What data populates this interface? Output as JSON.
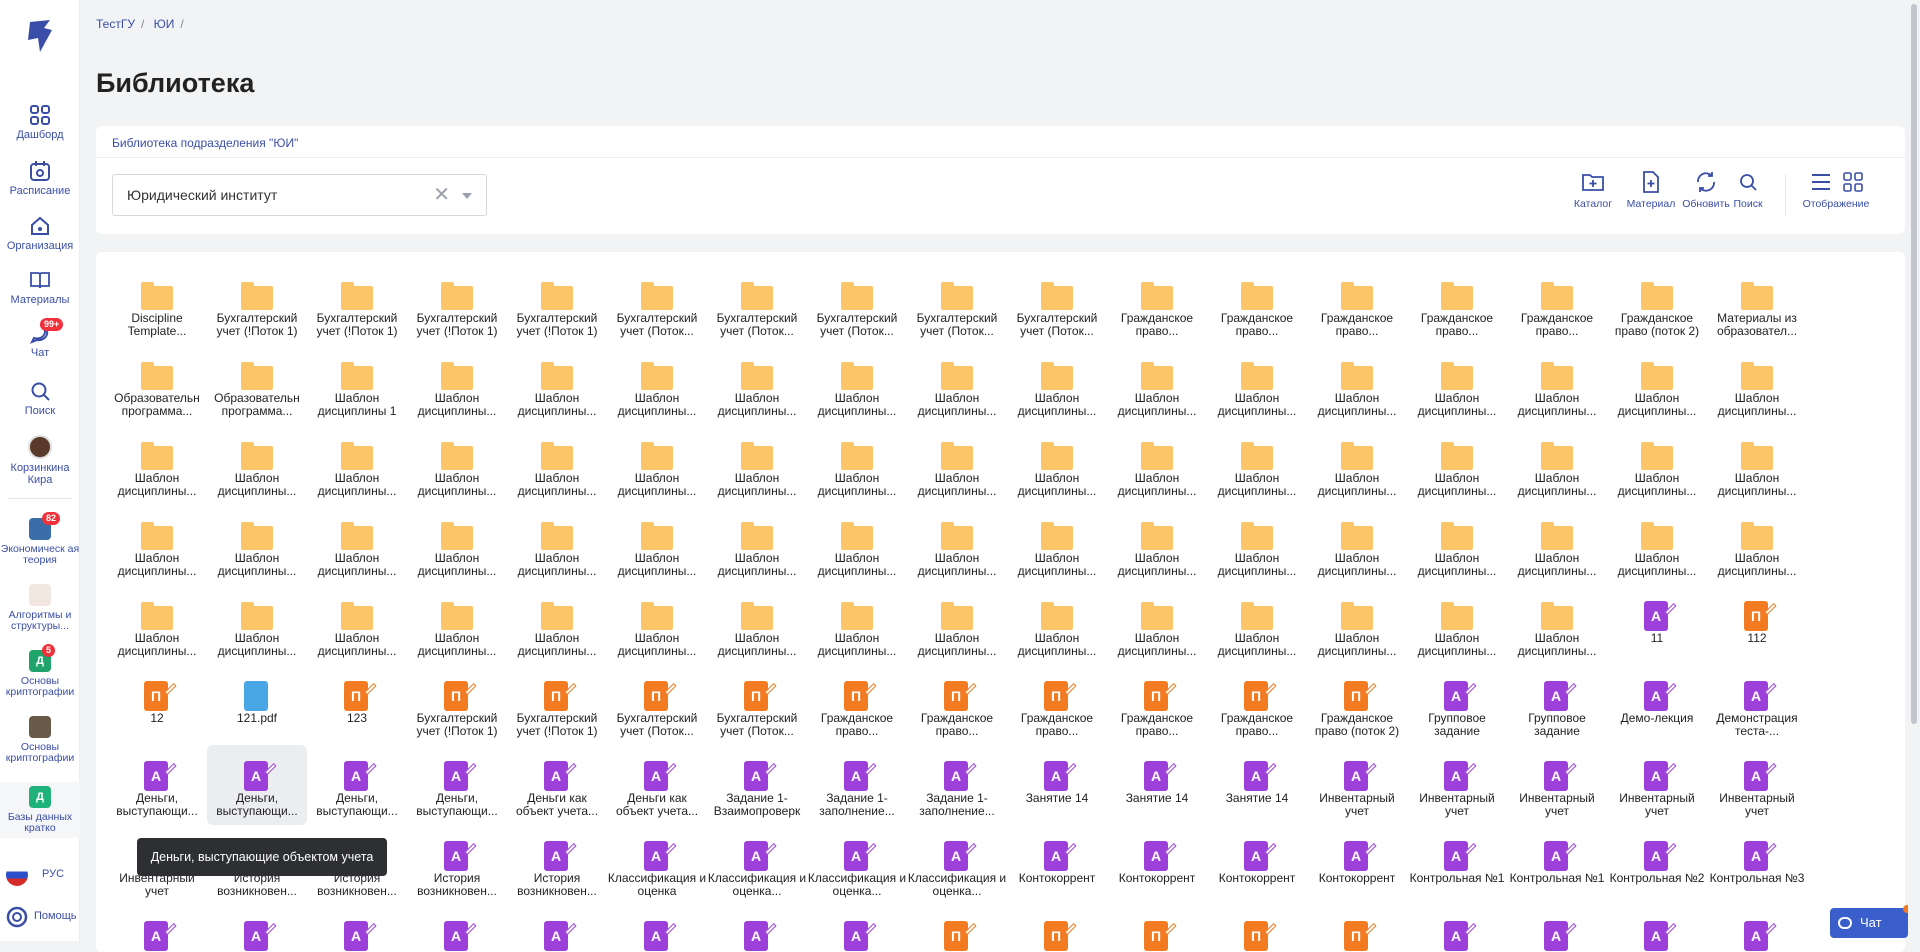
{
  "sidebar": {
    "items": [
      {
        "label": "Дашборд",
        "icon": "grid-icon"
      },
      {
        "label": "Расписание",
        "icon": "calendar-icon"
      },
      {
        "label": "Организация",
        "icon": "home-icon"
      },
      {
        "label": "Материалы",
        "icon": "book-icon"
      },
      {
        "label": "Чат",
        "icon": "chat-icon",
        "badge": "99+"
      },
      {
        "label": "Поиск",
        "icon": "search-icon"
      }
    ],
    "user": {
      "name": "Корзинкина Кира"
    },
    "courses": [
      {
        "label": "Экономическ ая теория",
        "badge": "82",
        "color": "#3b6ea8",
        "letter": ""
      },
      {
        "label": "Алгоритмы и структуры...",
        "badge": "",
        "color": "#8a6a5a",
        "letter": ""
      },
      {
        "label": "Основы криптографии",
        "badge": "5",
        "color": "#1fa36b",
        "letter": "Д"
      },
      {
        "label": "Основы криптографии",
        "badge": "",
        "color": "#6a5a4a",
        "letter": ""
      },
      {
        "label": "Базы данных кратко",
        "badge": "",
        "color": "#1fb37b",
        "letter": "Д"
      }
    ],
    "language": "РУС",
    "help": "Помощь"
  },
  "breadcrumb": [
    "ТестГУ",
    "ЮИ"
  ],
  "page_title": "Библиотека",
  "library_link": "Библиотека подразделения \"ЮИ\"",
  "department_select": {
    "value": "Юридический институт"
  },
  "toolbar": {
    "catalog": "Каталог",
    "material": "Материал",
    "refresh": "Обновить",
    "search": "Поиск",
    "display": "Отображение"
  },
  "grid_items": [
    {
      "type": "folder",
      "label": "Discipline Template..."
    },
    {
      "type": "folder",
      "label": "Бухгалтерский учет (!Поток 1)"
    },
    {
      "type": "folder",
      "label": "Бухгалтерский учет (!Поток 1)"
    },
    {
      "type": "folder",
      "label": "Бухгалтерский учет (!Поток 1)"
    },
    {
      "type": "folder",
      "label": "Бухгалтерский учет (!Поток 1)"
    },
    {
      "type": "folder",
      "label": "Бухгалтерский учет (Поток..."
    },
    {
      "type": "folder",
      "label": "Бухгалтерский учет (Поток..."
    },
    {
      "type": "folder",
      "label": "Бухгалтерский учет (Поток..."
    },
    {
      "type": "folder",
      "label": "Бухгалтерский учет (Поток..."
    },
    {
      "type": "folder",
      "label": "Бухгалтерский учет (Поток..."
    },
    {
      "type": "folder",
      "label": "Гражданское право..."
    },
    {
      "type": "folder",
      "label": "Гражданское право..."
    },
    {
      "type": "folder",
      "label": "Гражданское право..."
    },
    {
      "type": "folder",
      "label": "Гражданское право..."
    },
    {
      "type": "folder",
      "label": "Гражданское право..."
    },
    {
      "type": "folder",
      "label": "Гражданское право (поток 2)"
    },
    {
      "type": "folder",
      "label": "Материалы из образовател..."
    },
    {
      "type": "folder",
      "label": "Образовательн программа..."
    },
    {
      "type": "folder",
      "label": "Образовательн программа..."
    },
    {
      "type": "folder",
      "label": "Шаблон дисциплины 1"
    },
    {
      "type": "folder",
      "label": "Шаблон дисциплины..."
    },
    {
      "type": "folder",
      "label": "Шаблон дисциплины..."
    },
    {
      "type": "folder",
      "label": "Шаблон дисциплины..."
    },
    {
      "type": "folder",
      "label": "Шаблон дисциплины..."
    },
    {
      "type": "folder",
      "label": "Шаблон дисциплины..."
    },
    {
      "type": "folder",
      "label": "Шаблон дисциплины..."
    },
    {
      "type": "folder",
      "label": "Шаблон дисциплины..."
    },
    {
      "type": "folder",
      "label": "Шаблон дисциплины..."
    },
    {
      "type": "folder",
      "label": "Шаблон дисциплины..."
    },
    {
      "type": "folder",
      "label": "Шаблон дисциплины..."
    },
    {
      "type": "folder",
      "label": "Шаблон дисциплины..."
    },
    {
      "type": "folder",
      "label": "Шаблон дисциплины..."
    },
    {
      "type": "folder",
      "label": "Шаблон дисциплины..."
    },
    {
      "type": "folder",
      "label": "Шаблон дисциплины..."
    },
    {
      "type": "folder",
      "label": "Шаблон дисциплины..."
    },
    {
      "type": "folder",
      "label": "Шаблон дисциплины..."
    },
    {
      "type": "folder",
      "label": "Шаблон дисциплины..."
    },
    {
      "type": "folder",
      "label": "Шаблон дисциплины..."
    },
    {
      "type": "folder",
      "label": "Шаблон дисциплины..."
    },
    {
      "type": "folder",
      "label": "Шаблон дисциплины..."
    },
    {
      "type": "folder",
      "label": "Шаблон дисциплины..."
    },
    {
      "type": "folder",
      "label": "Шаблон дисциплины..."
    },
    {
      "type": "folder",
      "label": "Шаблон дисциплины..."
    },
    {
      "type": "folder",
      "label": "Шаблон дисциплины..."
    },
    {
      "type": "folder",
      "label": "Шаблон дисциплины..."
    },
    {
      "type": "folder",
      "label": "Шаблон дисциплины..."
    },
    {
      "type": "folder",
      "label": "Шаблон дисциплины..."
    },
    {
      "type": "folder",
      "label": "Шаблон дисциплины..."
    },
    {
      "type": "folder",
      "label": "Шаблон дисциплины..."
    },
    {
      "type": "folder",
      "label": "Шаблон дисциплины..."
    },
    {
      "type": "folder",
      "label": "Шаблон дисциплины..."
    },
    {
      "type": "folder",
      "label": "Шаблон дисциплины..."
    },
    {
      "type": "folder",
      "label": "Шаблон дисциплины..."
    },
    {
      "type": "folder",
      "label": "Шаблон дисциплины..."
    },
    {
      "type": "folder",
      "label": "Шаблон дисциплины..."
    },
    {
      "type": "folder",
      "label": "Шаблон дисциплины..."
    },
    {
      "type": "folder",
      "label": "Шаблон дисциплины..."
    },
    {
      "type": "folder",
      "label": "Шаблон дисциплины..."
    },
    {
      "type": "folder",
      "label": "Шаблон дисциплины..."
    },
    {
      "type": "folder",
      "label": "Шаблон дисциплины..."
    },
    {
      "type": "folder",
      "label": "Шаблон дисциплины..."
    },
    {
      "type": "folder",
      "label": "Шаблон дисциплины..."
    },
    {
      "type": "folder",
      "label": "Шаблон дисциплины..."
    },
    {
      "type": "folder",
      "label": "Шаблон дисциплины..."
    },
    {
      "type": "folder",
      "label": "Шаблон дисциплины..."
    },
    {
      "type": "folder",
      "label": "Шаблон дисциплины..."
    },
    {
      "type": "folder",
      "label": "Шаблон дисциплины..."
    },
    {
      "type": "folder",
      "label": "Шаблон дисциплины..."
    },
    {
      "type": "folder",
      "label": "Шаблон дисциплины..."
    },
    {
      "type": "folder",
      "label": "Шаблон дисциплины..."
    },
    {
      "type": "folder",
      "label": "Шаблон дисциплины..."
    },
    {
      "type": "folder",
      "label": "Шаблон дисциплины..."
    },
    {
      "type": "folder",
      "label": "Шаблон дисциплины..."
    },
    {
      "type": "folder",
      "label": "Шаблон дисциплины..."
    },
    {
      "type": "folder",
      "label": "Шаблон дисциплины..."
    },
    {
      "type": "folder",
      "label": "Шаблон дисциплины..."
    },
    {
      "type": "folder",
      "label": "Шаблон дисциплины..."
    },
    {
      "type": "folder",
      "label": "Шаблон дисциплины..."
    },
    {
      "type": "folder",
      "label": "Шаблон дисциплины..."
    },
    {
      "type": "folder",
      "label": "Шаблон дисциплины..."
    },
    {
      "type": "folder",
      "label": "Шаблон дисциплины..."
    },
    {
      "type": "folder",
      "label": "Шаблон дисциплины..."
    },
    {
      "type": "folder",
      "label": "Шаблон дисциплины..."
    },
    {
      "type": "test",
      "label": "11"
    },
    {
      "type": "lecture",
      "label": "112"
    },
    {
      "type": "lecture",
      "label": "12"
    },
    {
      "type": "pdf",
      "label": "121.pdf"
    },
    {
      "type": "lecture",
      "label": "123"
    },
    {
      "type": "lecture",
      "label": "Бухгалтерский учет (!Поток 1)"
    },
    {
      "type": "lecture",
      "label": "Бухгалтерский учет (!Поток 1)"
    },
    {
      "type": "lecture",
      "label": "Бухгалтерский учет (Поток..."
    },
    {
      "type": "lecture",
      "label": "Бухгалтерский учет (Поток..."
    },
    {
      "type": "lecture",
      "label": "Гражданское право..."
    },
    {
      "type": "lecture",
      "label": "Гражданское право..."
    },
    {
      "type": "lecture",
      "label": "Гражданское право..."
    },
    {
      "type": "lecture",
      "label": "Гражданское право..."
    },
    {
      "type": "lecture",
      "label": "Гражданское право..."
    },
    {
      "type": "lecture",
      "label": "Гражданское право (поток 2)"
    },
    {
      "type": "test",
      "label": "Групповое задание"
    },
    {
      "type": "test",
      "label": "Групповое задание"
    },
    {
      "type": "test",
      "label": "Демо-лекция"
    },
    {
      "type": "test",
      "label": "Демонстрация теста-..."
    },
    {
      "type": "test",
      "label": "Деньги, выступающи..."
    },
    {
      "type": "test",
      "label": "Деньги, выступающи...",
      "hover": true
    },
    {
      "type": "test",
      "label": "Деньги, выступающи..."
    },
    {
      "type": "test",
      "label": "Деньги, выступающи..."
    },
    {
      "type": "test",
      "label": "Деньги как объект учета..."
    },
    {
      "type": "test",
      "label": "Деньги как объект учета..."
    },
    {
      "type": "test",
      "label": "Задание 1- Взаимопроверк"
    },
    {
      "type": "test",
      "label": "Задание 1- заполнение..."
    },
    {
      "type": "test",
      "label": "Задание 1- заполнение..."
    },
    {
      "type": "test",
      "label": "Занятие 14"
    },
    {
      "type": "test",
      "label": "Занятие 14"
    },
    {
      "type": "test",
      "label": "Занятие 14"
    },
    {
      "type": "test",
      "label": "Инвентарный учет"
    },
    {
      "type": "test",
      "label": "Инвентарный учет"
    },
    {
      "type": "test",
      "label": "Инвентарный учет"
    },
    {
      "type": "test",
      "label": "Инвентарный учет"
    },
    {
      "type": "test",
      "label": "Инвентарный учет"
    },
    {
      "type": "test",
      "label": "Инвентарный учет"
    },
    {
      "type": "test",
      "label": "История возникновен..."
    },
    {
      "type": "test",
      "label": "История возникновен..."
    },
    {
      "type": "test",
      "label": "История возникновен..."
    },
    {
      "type": "test",
      "label": "История возникновен..."
    },
    {
      "type": "test",
      "label": "Классификация и оценка"
    },
    {
      "type": "test",
      "label": "Классификация и оценка..."
    },
    {
      "type": "test",
      "label": "Классификация и оценка..."
    },
    {
      "type": "test",
      "label": "Классификация и оценка..."
    },
    {
      "type": "test",
      "label": "Контокоррент"
    },
    {
      "type": "test",
      "label": "Контокоррент"
    },
    {
      "type": "test",
      "label": "Контокоррент"
    },
    {
      "type": "test",
      "label": "Контокоррент"
    },
    {
      "type": "test",
      "label": "Контрольная №1"
    },
    {
      "type": "test",
      "label": "Контрольная №1"
    },
    {
      "type": "test",
      "label": "Контрольная №2"
    },
    {
      "type": "test",
      "label": "Контрольная №3"
    },
    {
      "type": "test",
      "label": ""
    },
    {
      "type": "test",
      "label": ""
    },
    {
      "type": "test",
      "label": ""
    },
    {
      "type": "test",
      "label": ""
    },
    {
      "type": "test",
      "label": ""
    },
    {
      "type": "test",
      "label": ""
    },
    {
      "type": "test",
      "label": ""
    },
    {
      "type": "test",
      "label": ""
    },
    {
      "type": "lecture",
      "label": ""
    },
    {
      "type": "lecture",
      "label": ""
    },
    {
      "type": "lecture",
      "label": ""
    },
    {
      "type": "lecture",
      "label": ""
    },
    {
      "type": "lecture",
      "label": ""
    },
    {
      "type": "test",
      "label": ""
    },
    {
      "type": "test",
      "label": ""
    },
    {
      "type": "test",
      "label": ""
    },
    {
      "type": "test",
      "label": ""
    }
  ],
  "tooltip": "Деньги, выступающие объектом учета",
  "chat_button": "Чат",
  "icon_letters": {
    "lecture": "П",
    "test": "А",
    "pdf": ""
  },
  "colors": {
    "accent": "#3a4ea8",
    "folder": "#fcc567",
    "lecture": "#f27a20",
    "test": "#9d3fd9",
    "pdf": "#4aa7e6"
  }
}
